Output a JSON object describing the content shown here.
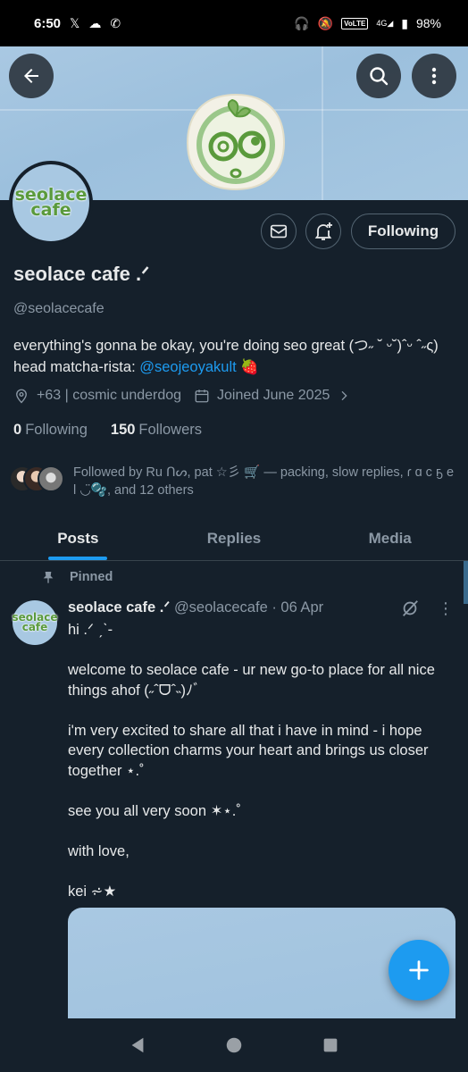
{
  "status_bar": {
    "time": "6:50",
    "x_icon": "𝕏",
    "network": "4G",
    "volte": "VoLTE",
    "battery": "98%"
  },
  "profile": {
    "display_name": "seolace cafe .ᐟ",
    "handle": "@seolacecafe",
    "avatar_text_1": "seolace",
    "avatar_text_2": "cafe",
    "bio_text": "everything's gonna be okay, you're doing seo great (つ˶ ˘ ᵕ˘)ˆᵕ ˆ˶ς) head matcha-rista: ",
    "bio_mention": "@seojeoyakult",
    "bio_emoji": "🍓",
    "location": "+63 | cosmic underdog",
    "joined": "Joined June 2025",
    "following_count": "0",
    "following_label": "Following",
    "followers_count": "150",
    "followers_label": "Followers",
    "followed_by": "Followed by Ru ᑎᔕ, pat ☆彡 🛒 — packing, slow replies, ɾ ɑ c ҕ e l ◡̈🫧, and 12 others",
    "follow_button": "Following"
  },
  "tabs": [
    {
      "label": "Posts",
      "active": true
    },
    {
      "label": "Replies",
      "active": false
    },
    {
      "label": "Media",
      "active": false
    }
  ],
  "post": {
    "pinned_label": "Pinned",
    "author": "seolace cafe .ᐟ",
    "handle_date": "@seolacecafe · 06 Apr",
    "paragraphs": [
      "hi .ᐟ ˏˋ-",
      "welcome to seolace cafe - ur new go-to place for all nice things ahof (˶ˆᗜˆ˵)ﾉﾞ",
      "i'm very excited to share all that i have in mind - i hope every collection charms your heart and brings us closer together ⋆.˚",
      "see you all very soon ✶⋆.˚",
      "with love,",
      "kei ⩫★"
    ]
  },
  "colors": {
    "background": "#15202b",
    "accent": "#1d9bf0",
    "banner": "#a9c8e2",
    "muted": "#8b98a5"
  },
  "icons": [
    "back-arrow-icon",
    "search-icon",
    "more-vertical-icon",
    "mail-icon",
    "bell-plus-icon",
    "location-icon",
    "calendar-icon",
    "chevron-right-icon",
    "pin-icon",
    "grok-icon",
    "plus-icon"
  ]
}
